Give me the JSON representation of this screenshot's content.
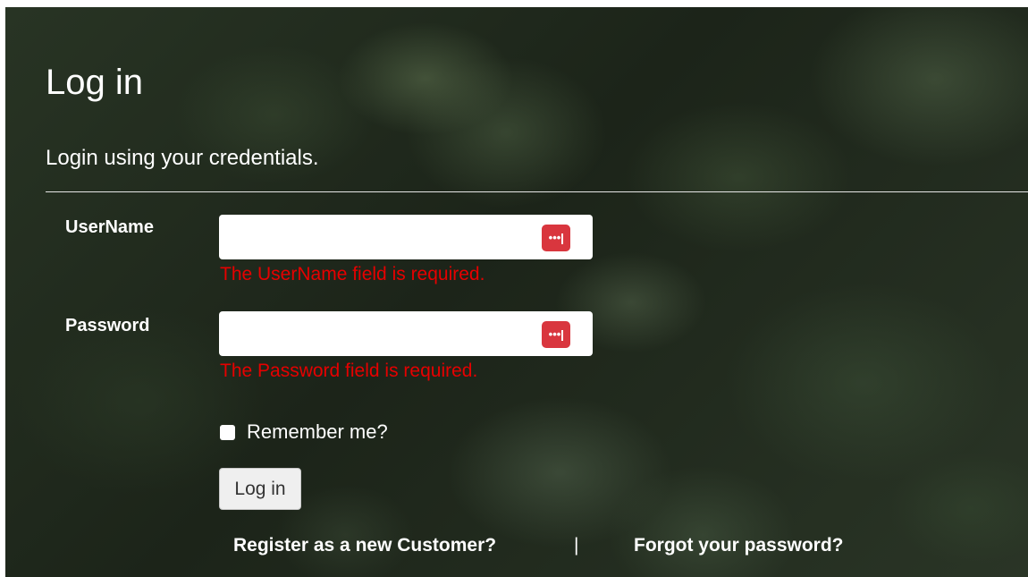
{
  "page": {
    "title": "Log in",
    "subtitle": "Login using your credentials."
  },
  "form": {
    "username": {
      "label": "UserName",
      "value": "",
      "error": "The UserName field is required.",
      "icon": "password-manager-icon"
    },
    "password": {
      "label": "Password",
      "value": "",
      "error": "The Password field is required.",
      "icon": "password-manager-icon"
    },
    "remember": {
      "label": "Remember me?",
      "checked": false
    },
    "submit_label": "Log in"
  },
  "links": {
    "register": "Register as a new Customer?",
    "separator": "|",
    "forgot": "Forgot your password?"
  },
  "colors": {
    "error": "#e60000",
    "icon_badge": "#d9363e"
  }
}
